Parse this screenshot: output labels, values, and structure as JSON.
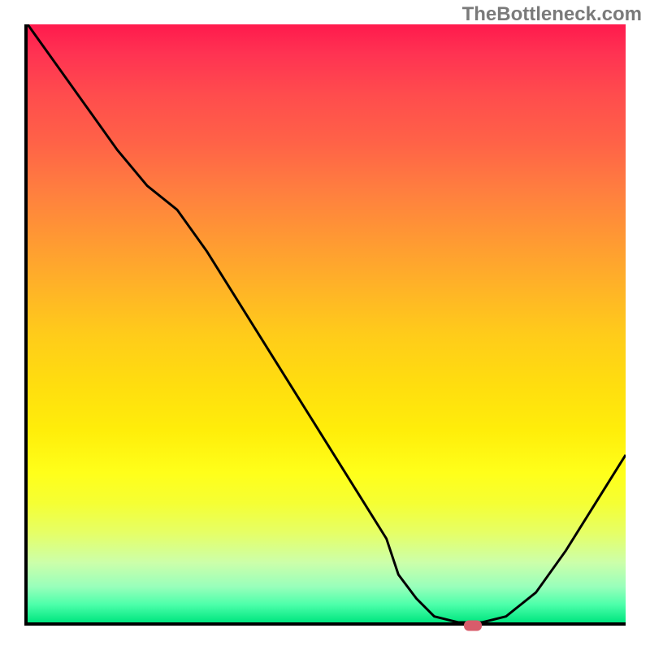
{
  "watermark": "TheBottleneck.com",
  "chart_data": {
    "type": "line",
    "title": "",
    "xlabel": "",
    "ylabel": "",
    "x": [
      0,
      5,
      10,
      15,
      20,
      25,
      30,
      35,
      40,
      45,
      50,
      55,
      60,
      62,
      65,
      68,
      72,
      76,
      80,
      85,
      90,
      95,
      100
    ],
    "values": [
      100,
      93,
      86,
      79,
      73,
      69,
      62,
      54,
      46,
      38,
      30,
      22,
      14,
      8,
      4,
      1,
      0,
      0,
      1,
      5,
      12,
      20,
      28
    ],
    "xlim": [
      0,
      100
    ],
    "ylim": [
      0,
      100
    ],
    "marker_position": {
      "x": 74,
      "y": 0
    },
    "gradient_colors": {
      "top": "#ff1a4d",
      "middle": "#ffdd0f",
      "bottom": "#00e680"
    }
  }
}
